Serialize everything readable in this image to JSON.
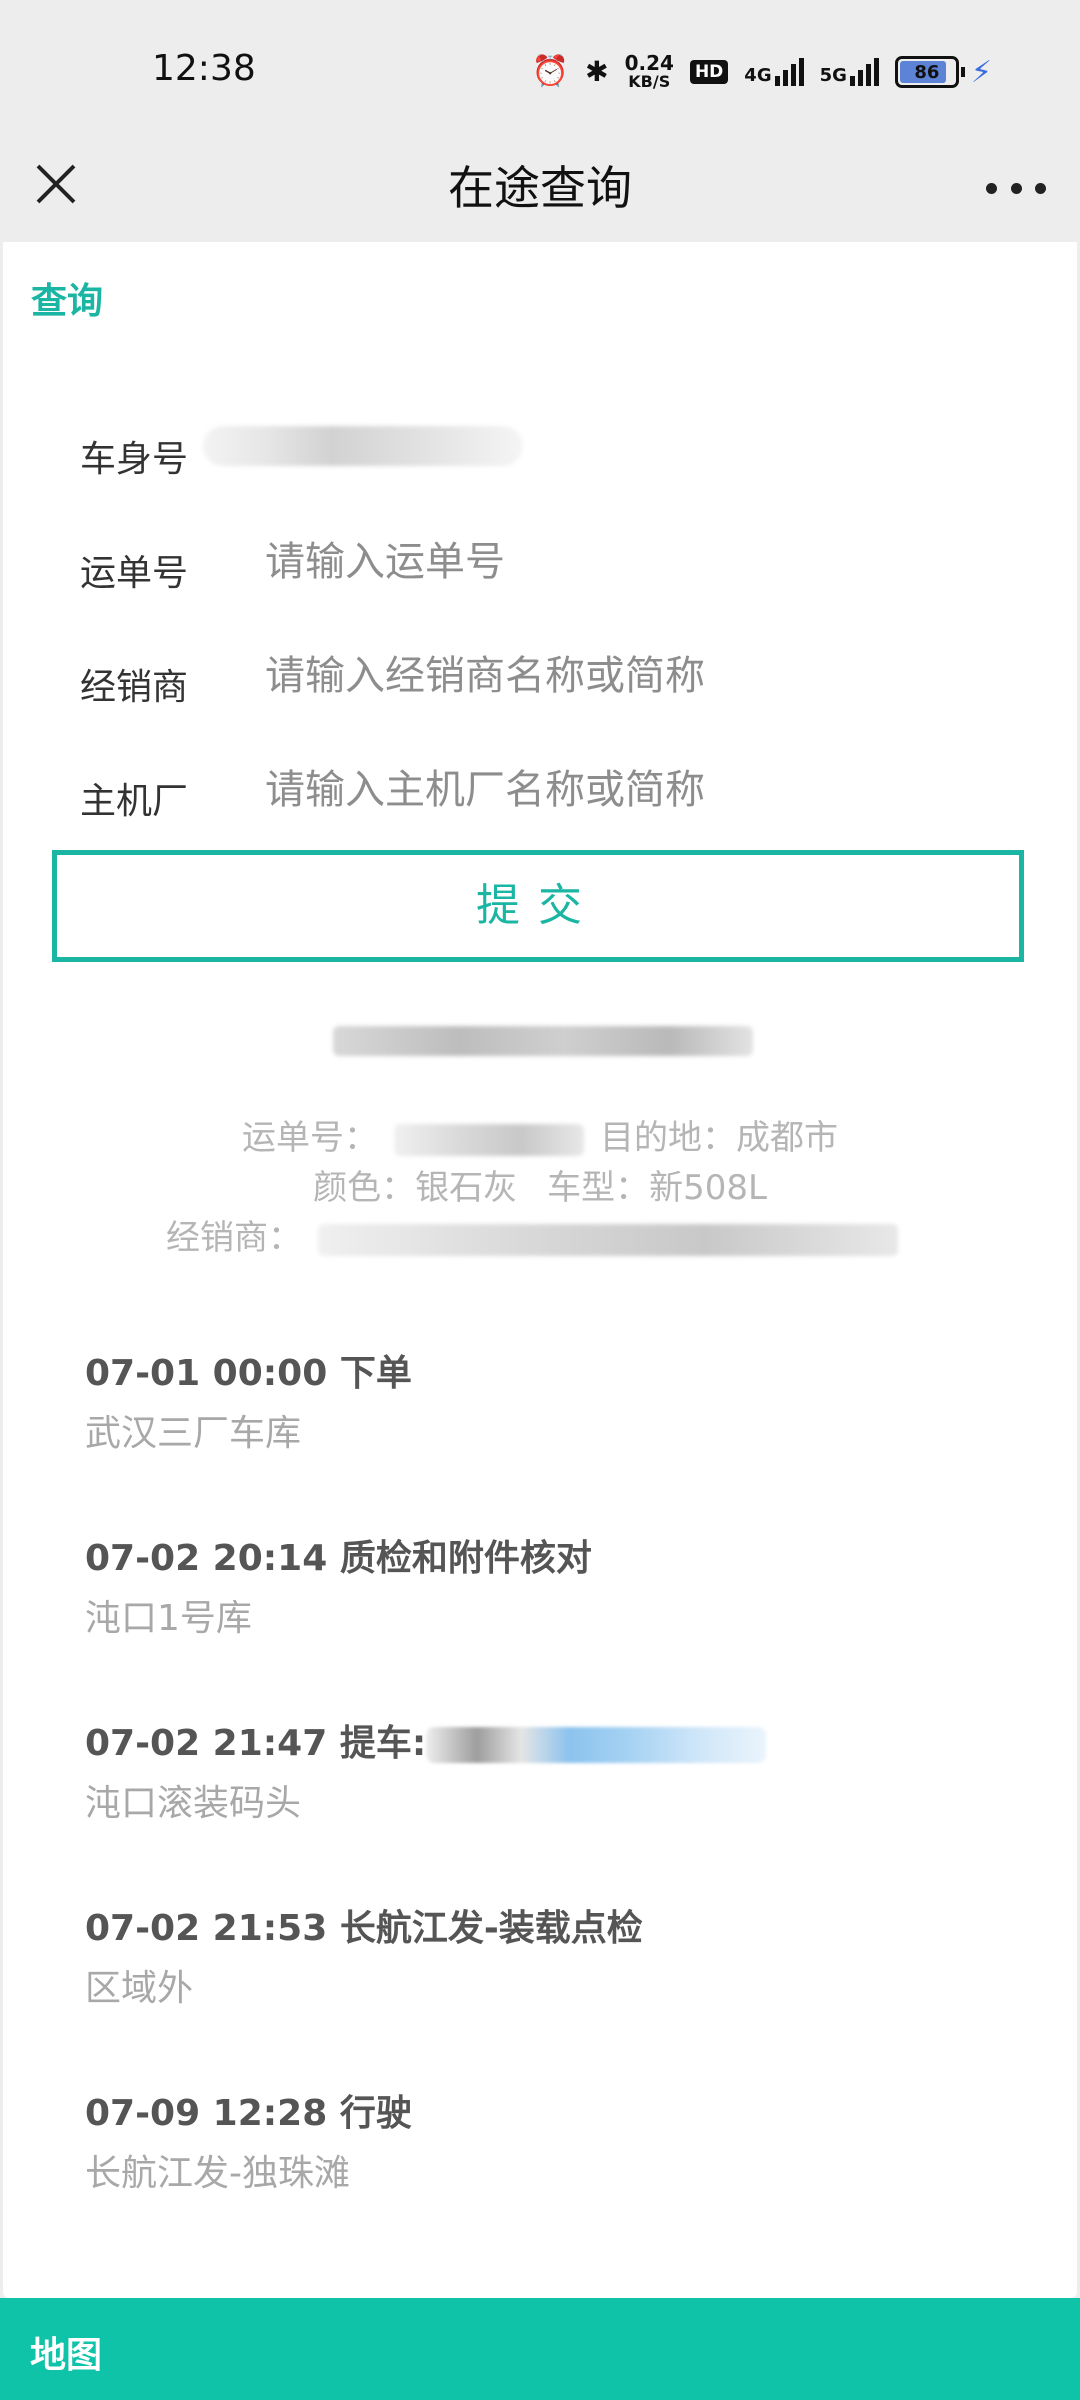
{
  "status_bar": {
    "time": "12:38",
    "net_speed_value": "0.24",
    "net_speed_unit": "KB/S",
    "hd_badge": "HD",
    "signal_1": "4G",
    "signal_2": "5G",
    "battery_level": "86",
    "battery_fraction": 0.86
  },
  "header": {
    "title": "在途查询"
  },
  "query": {
    "section_label": "查询",
    "fields": [
      {
        "label": "车身号",
        "value": "",
        "placeholder": ""
      },
      {
        "label": "运单号",
        "value": "",
        "placeholder": "请输入运单号"
      },
      {
        "label": "经销商",
        "value": "",
        "placeholder": "请输入经销商名称或简称"
      },
      {
        "label": "主机厂",
        "value": "",
        "placeholder": "请输入主机厂名称或简称"
      }
    ],
    "submit_label": "提交"
  },
  "summary": {
    "waybill_label": "运单号：",
    "destination_label": "目的地：",
    "destination": "成都市",
    "color_label": "颜色：",
    "color": "银石灰",
    "model_label": "车型：",
    "model": "新508L",
    "dealer_label": "经销商："
  },
  "timeline": [
    {
      "time": "07-01 00:00",
      "event": "下单",
      "location": "武汉三厂车库"
    },
    {
      "time": "07-02 20:14",
      "event": "质检和附件核对",
      "location": "沌口1号库"
    },
    {
      "time": "07-02 21:47",
      "event": "提车:",
      "location": "沌口滚装码头"
    },
    {
      "time": "07-02 21:53",
      "event": "长航江发-装载点检",
      "location": "区域外"
    },
    {
      "time": "07-09 12:28",
      "event": "行驶",
      "location": "长航江发-独珠滩"
    }
  ],
  "bottom": {
    "label": "地图"
  },
  "colors": {
    "accent": "#1bb5a3",
    "bottom_bar": "#0ec3a8",
    "background": "#ededed"
  }
}
